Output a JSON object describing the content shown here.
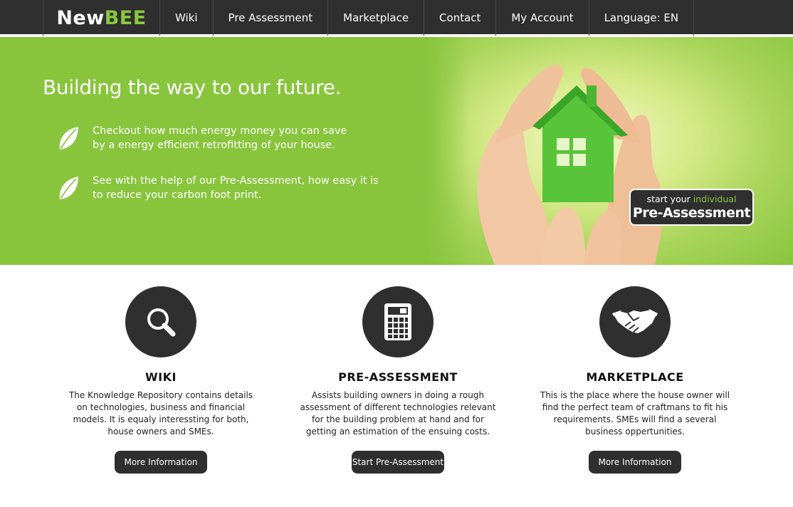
{
  "nav": {
    "logo_part1": "New",
    "logo_part2": "BEE",
    "items": [
      "Wiki",
      "Pre Assessment",
      "Marketplace",
      "Contact",
      "My Account",
      "Language: EN"
    ]
  },
  "hero": {
    "title": "Building the way to our future.",
    "bullets": [
      {
        "line1": "Checkout how much energy money you can save",
        "line2": "by a energy efficient retrofitting of your house."
      },
      {
        "line1": "See with the help of our Pre-Assessment, how easy it is",
        "line2": "to reduce your carbon foot print."
      }
    ],
    "cta": {
      "prefix": "start your ",
      "highlight": "individual",
      "main": "Pre-Assessment"
    }
  },
  "features": [
    {
      "icon": "magnifier-icon",
      "title": "WIKI",
      "text": "The Knowledge Repository contains details on technologies, business and financial models. It is equaly interessting for both, house owners and SMEs.",
      "button": "More Information"
    },
    {
      "icon": "calculator-icon",
      "title": "PRE-ASSESSMENT",
      "text": "Assists building owners in doing a rough assessment of different technologies relevant for the building problem at hand and for getting an estimation of the ensuing costs.",
      "button": "Start Pre-Assessment"
    },
    {
      "icon": "handshake-icon",
      "title": "MARKETPLACE",
      "text": "This is the place where the house owner will find the perfect team of craftmans to fit his requirements. SMEs will find a several business oppertunities.",
      "button": "More Information"
    }
  ],
  "colors": {
    "nav_bg": "#2f2f2f",
    "accent_green": "#88c53d",
    "logo_green": "#8cc63f"
  }
}
